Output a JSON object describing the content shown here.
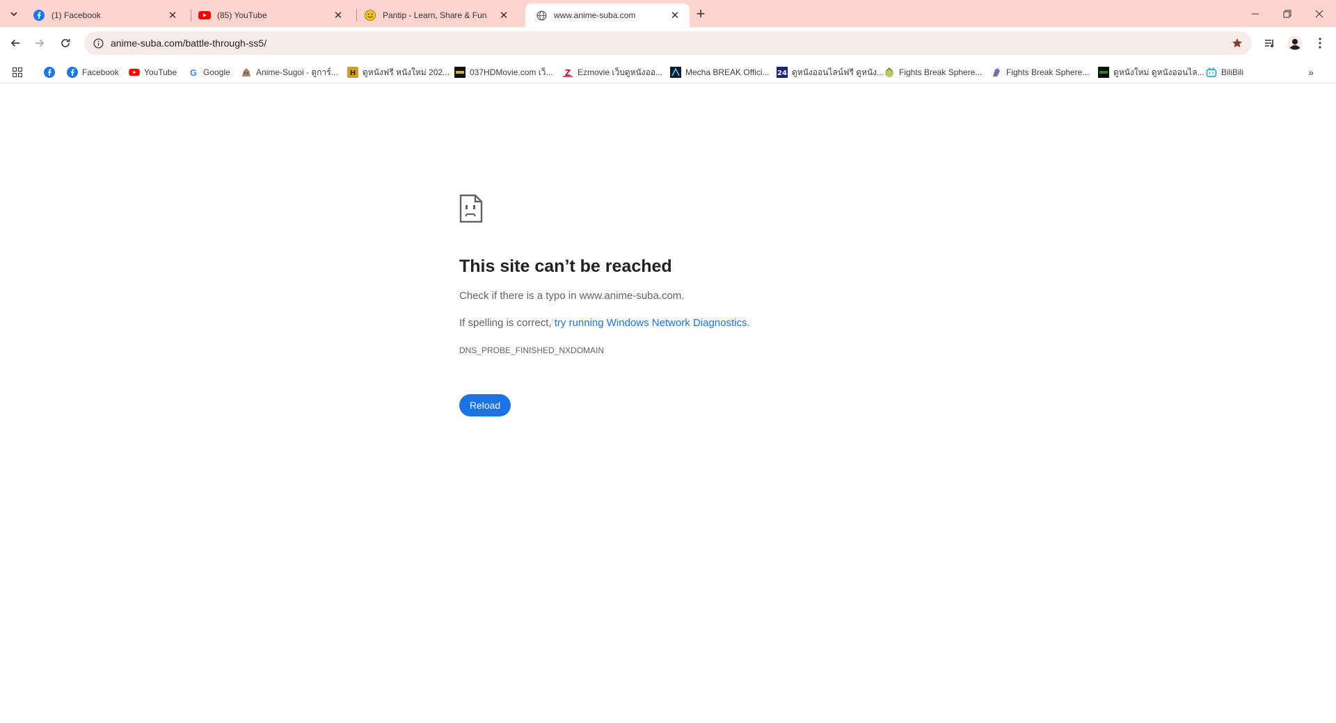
{
  "tabs": [
    {
      "title": "(1) Facebook",
      "icon": "facebook-icon",
      "active": false
    },
    {
      "title": "(85) YouTube",
      "icon": "youtube-icon",
      "active": false
    },
    {
      "title": "Pantip - Learn, Share & Fun",
      "icon": "pantip-icon",
      "active": false
    },
    {
      "title": "www.anime-suba.com",
      "icon": "globe-icon",
      "active": true
    }
  ],
  "toolbar": {
    "url": "anime-suba.com/battle-through-ss5/"
  },
  "bookmarks": [
    {
      "label": "",
      "icon": "facebook-icon"
    },
    {
      "label": "Facebook",
      "icon": "facebook-icon"
    },
    {
      "label": "YouTube",
      "icon": "youtube-icon"
    },
    {
      "label": "Google",
      "icon": "google-icon"
    },
    {
      "label": "Anime-Sugoi - ดูการ์...",
      "icon": "anime-sugoi-icon"
    },
    {
      "label": "ดูหนังฟรี หนังใหม่ 202...",
      "icon": "movie-site-icon"
    },
    {
      "label": "037HDMovie.com เว็...",
      "icon": "037hd-icon"
    },
    {
      "label": "Ezmovie เว็บดูหนังออ...",
      "icon": "ezmovie-icon"
    },
    {
      "label": "Mecha BREAK Offici...",
      "icon": "mecha-break-icon"
    },
    {
      "label": "ดูหนังออนไลน์ฟรี ดูหนัง...",
      "icon": "movie-online-icon"
    },
    {
      "label": "Fights Break Sphere...",
      "icon": "fights-break-icon"
    },
    {
      "label": "Fights Break Sphere...",
      "icon": "fights-break-icon-2"
    },
    {
      "label": "ดูหนังใหม่ ดูหนังออนไล...",
      "icon": "movie-new-icon"
    },
    {
      "label": "BiliBili",
      "icon": "bilibili-icon"
    }
  ],
  "error": {
    "title": "This site can’t be reached",
    "typo_text": "Check if there is a typo in www.anime-suba.com.",
    "spelling_prefix": "If spelling is correct, ",
    "diagnostics_link": "try running Windows Network Diagnostics",
    "spelling_suffix": ".",
    "code": "DNS_PROBE_FINISHED_NXDOMAIN",
    "reload_label": "Reload"
  },
  "colors": {
    "tabstrip": "#fdd4d0",
    "omnibox": "#f7ece9",
    "accent": "#1a73e8",
    "bookmark_star": "#8b3a2e"
  }
}
